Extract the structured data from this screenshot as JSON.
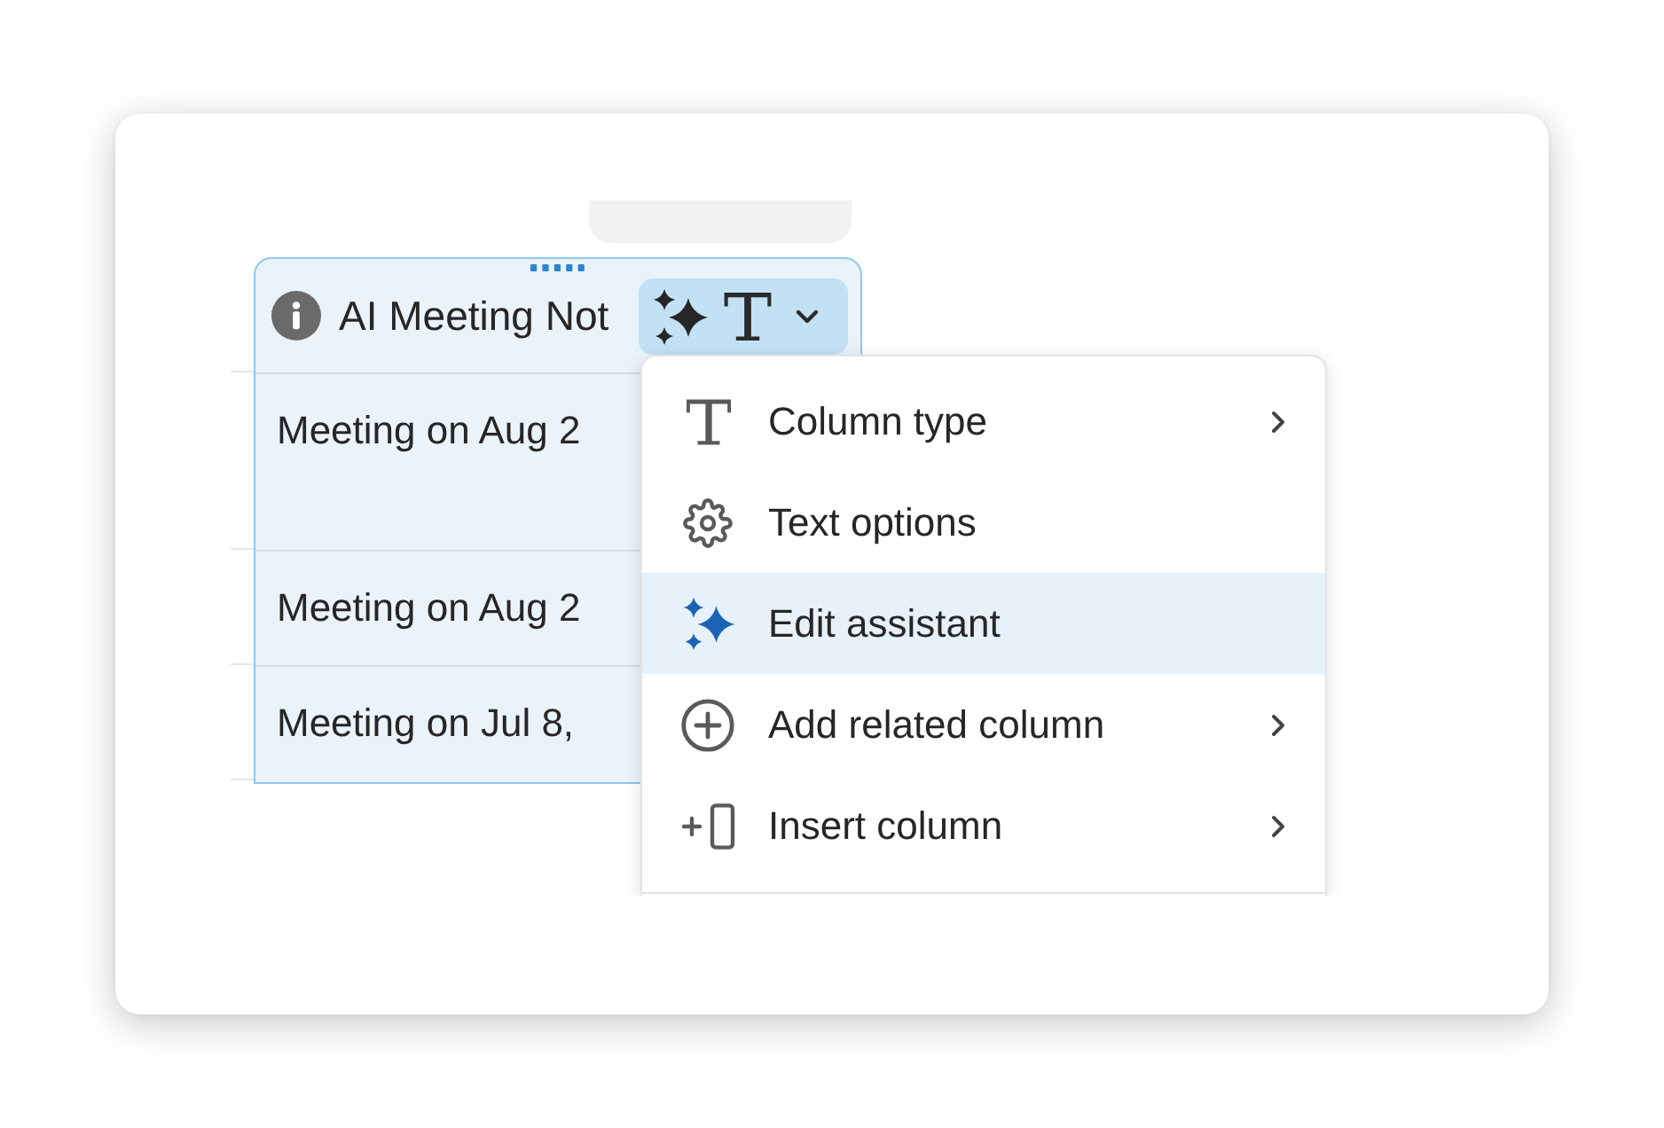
{
  "column": {
    "selected": true,
    "title": "AI Meeting Not",
    "type_button": {
      "expanded": true
    },
    "rows": [
      {
        "text": "Meeting on Aug 2"
      },
      {
        "text": "Meeting on Aug 2"
      },
      {
        "text": "Meeting on Jul 8,"
      }
    ]
  },
  "menu": {
    "items": [
      {
        "label": "Column type",
        "submenu": true,
        "selected": false
      },
      {
        "label": "Text options",
        "submenu": false,
        "selected": false
      },
      {
        "label": "Edit assistant",
        "submenu": false,
        "selected": true
      },
      {
        "label": "Add related column",
        "submenu": true,
        "selected": false
      },
      {
        "label": "Insert column",
        "submenu": true,
        "selected": false
      }
    ]
  }
}
